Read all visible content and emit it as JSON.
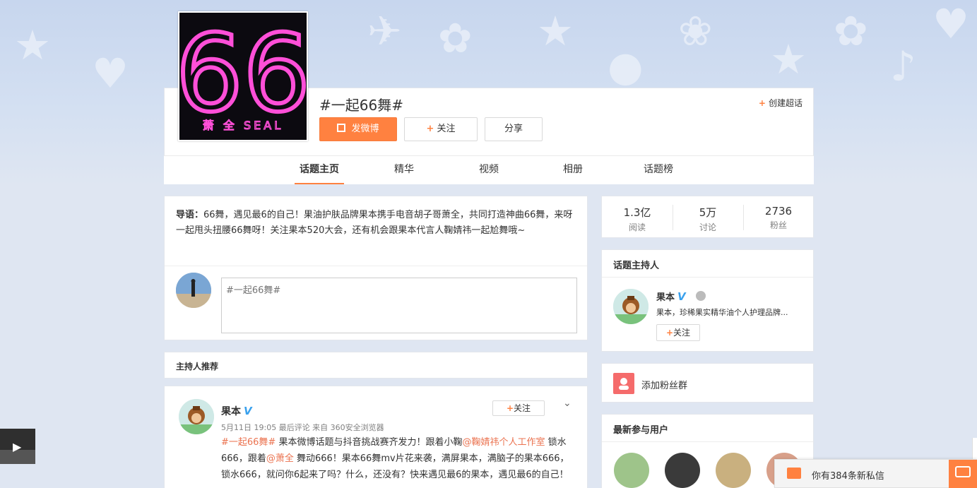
{
  "topic": {
    "title": "#一起66舞#",
    "cover_number": "66",
    "cover_caption": "萧 全 SEAL"
  },
  "header": {
    "create_super": "创建超话",
    "post_button": "发微博",
    "follow_button": "关注",
    "share_button": "分享"
  },
  "tabs": [
    "话题主页",
    "精华",
    "视频",
    "相册",
    "话题榜"
  ],
  "intro": {
    "label": "导语：",
    "text": "66舞，遇见最6的自己！果油护肤品牌果本携手电音胡子哥萧全，共同打造神曲66舞，来呀一起甩头扭腰66舞呀！关注果本520大会，还有机会跟果本代言人鞠婧祎一起尬舞哦~",
    "compose_placeholder": "#一起66舞#"
  },
  "host_recommend": {
    "title": "主持人推荐"
  },
  "feed_post": {
    "author": "果本",
    "verified": "V",
    "meta": "5月11日 19:05 最后评论 来自 360安全浏览器",
    "follow": "关注",
    "hashtag": "#一起66舞#",
    "text_part1": " 果本微博话题与抖音挑战赛齐发力！跟着小鞠",
    "mention1": "@鞠婧祎个人工作室",
    "text_part2": " 锁水666，跟着",
    "mention2": "@萧全",
    "text_part3": " 舞动666！果本66舞mv片花来袭，满屏果本，满脑子的果本666，锁水666，就问你6起来了吗？什么，还没有？快来遇见最6的果本，遇见最6的自己！"
  },
  "stats": [
    {
      "num": "1.3亿",
      "label": "阅读"
    },
    {
      "num": "5万",
      "label": "讨论"
    },
    {
      "num": "2736",
      "label": "粉丝"
    }
  ],
  "host": {
    "title": "话题主持人",
    "name": "果本",
    "verified": "V",
    "desc": "果本，珍稀果实精华油个人护理品牌...",
    "follow": "关注"
  },
  "fans_group": {
    "label": "添加粉丝群"
  },
  "latest": {
    "title": "最新参与用户"
  },
  "message": {
    "text": "你有384条新私信"
  },
  "colors": {
    "accent": "#ff8140",
    "link": "#eb7350",
    "verified": "#3aa1ed",
    "neon": "#ff4fd8"
  },
  "icons": {
    "post": "edit-icon",
    "follow": "plus-icon",
    "message": "mail-icon",
    "chat": "chat-bubble-icon",
    "video": "play-icon",
    "fans": "group-icon"
  }
}
